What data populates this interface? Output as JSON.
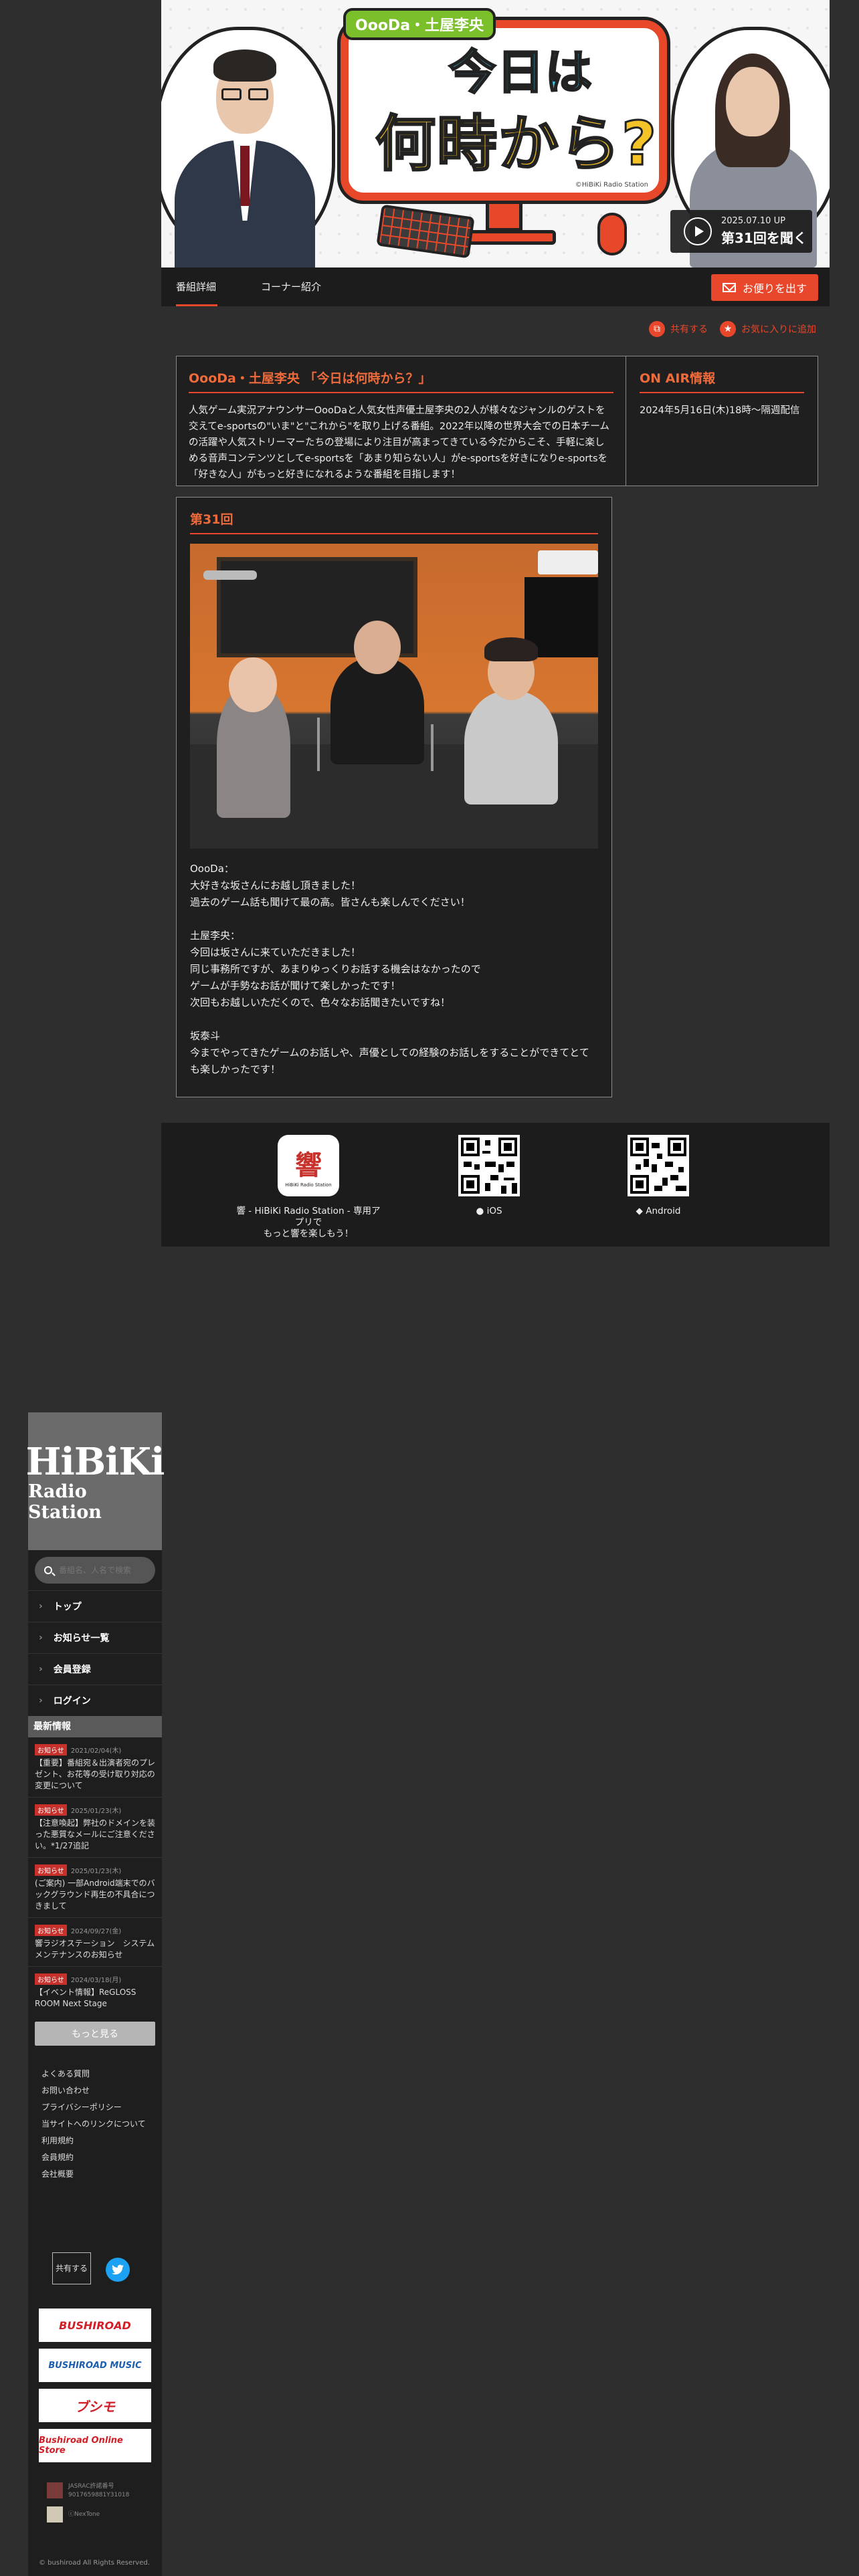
{
  "banner": {
    "logo_sub": "OooDa・土屋李央",
    "logo_line1": "今日は",
    "logo_line2": "何時から?",
    "monitor_credit": "©HiBiKi Radio Station",
    "listen_date": "2025.07.10 UP",
    "listen_label": "第31回を聞く"
  },
  "tabs": [
    {
      "label": "番組詳細"
    },
    {
      "label": "コーナー紹介"
    }
  ],
  "mail_button": "お便りを出す",
  "share": {
    "share_label": "共有する",
    "favorite_label": "お気に入りに追加"
  },
  "program": {
    "title": "OooDa・土屋李央 「今日は何時から？」",
    "description": "人気ゲーム実況アナウンサーOooDaと人気女性声優土屋李央の2人が様々なジャンルのゲストを交えてe-sportsの\"いま\"と\"これから\"を取り上げる番組。2022年以降の世界大会での日本チームの活躍や人気ストリーマーたちの登場により注目が高まってきている今だからこそ、手軽に楽しめる音声コンテンツとしてe-sportsを「あまり知らない人」がe-sportsを好きになりe-sportsを「好きな人」がもっと好きになれるような番組を目指します！"
  },
  "onair": {
    "title": "ON AIR情報",
    "schedule": "2024年5月16日(木)18時〜隔週配信"
  },
  "episode": {
    "title": "第31回",
    "lines": [
      "OooDa：",
      "大好きな坂さんにお越し頂きました！",
      "過去のゲーム話も聞けて最の高。皆さんも楽しんでください！",
      "",
      "土屋李央：",
      "今回は坂さんに来ていただきました！",
      "同じ事務所ですが、あまりゆっくりお話する機会はなかったので",
      "ゲームが手勢なお話が聞けて楽しかったです！",
      "次回もお越しいただくので、色々なお話聞きたいですね！",
      "",
      "坂泰斗",
      "今までやってきたゲームのお話しや、声優としての経験のお話しをすることができてとても楽しかったです！"
    ]
  },
  "apps": {
    "app_icon_text": "響",
    "app_icon_sub": "HiBiKi Radio Station",
    "app_desc_line1": "響 - HiBiKi Radio Station - 専用アプリで",
    "app_desc_line2": "もっと響を楽しもう！",
    "ios_label": "iOS",
    "android_label": "Android"
  },
  "sidebar": {
    "logo_line1": "HiBiKi",
    "logo_line2": "Radio Station",
    "search_placeholder": "番組名、人名で検索",
    "nav": [
      {
        "label": "トップ"
      },
      {
        "label": "お知らせ一覧"
      },
      {
        "label": "会員登録"
      },
      {
        "label": "ログイン"
      }
    ],
    "news_heading": "最新情報",
    "news": [
      {
        "badge": "お知らせ",
        "date": "2021/02/04(木)",
        "title": "【重要】番組宛＆出演者宛のプレゼント、お花等の受け取り対応の変更について"
      },
      {
        "badge": "お知らせ",
        "date": "2025/01/23(木)",
        "title": "【注意喚起】弊社のドメインを装った悪質なメールにご注意ください。*1/27追記"
      },
      {
        "badge": "お知らせ",
        "date": "2025/01/23(木)",
        "title": "(ご案内) 一部Android端末でのバックグラウンド再生の不具合につきまして"
      },
      {
        "badge": "お知らせ",
        "date": "2024/09/27(金)",
        "title": "響ラジオステーション　システムメンテナンスのお知らせ"
      },
      {
        "badge": "お知らせ",
        "date": "2024/03/18(月)",
        "title": "【イベント情報】ReGLOSS ROOM Next Stage"
      }
    ],
    "more_label": "もっと見る",
    "links": [
      "よくある質問",
      "お問い合わせ",
      "プライバシーポリシー",
      "当サイトへのリンクについて",
      "利用規約",
      "会員規約",
      "会社概要"
    ],
    "share_label": "共有する",
    "partners": [
      {
        "label": "BUSHIROAD",
        "color": "#d21f27"
      },
      {
        "label": "BUSHIROAD MUSIC",
        "color": "#1c5fb0"
      },
      {
        "label": "ブシモ",
        "color": "#d21f27"
      },
      {
        "label": "Bushiroad Online Store",
        "color": "#d21f27"
      }
    ],
    "jasrac_line1": "JASRAC許諾番号",
    "jasrac_line2": "9017659881Y31018",
    "nexone": "ⓒNexTone",
    "copyright": "© bushiroad All Rights Reserved."
  }
}
